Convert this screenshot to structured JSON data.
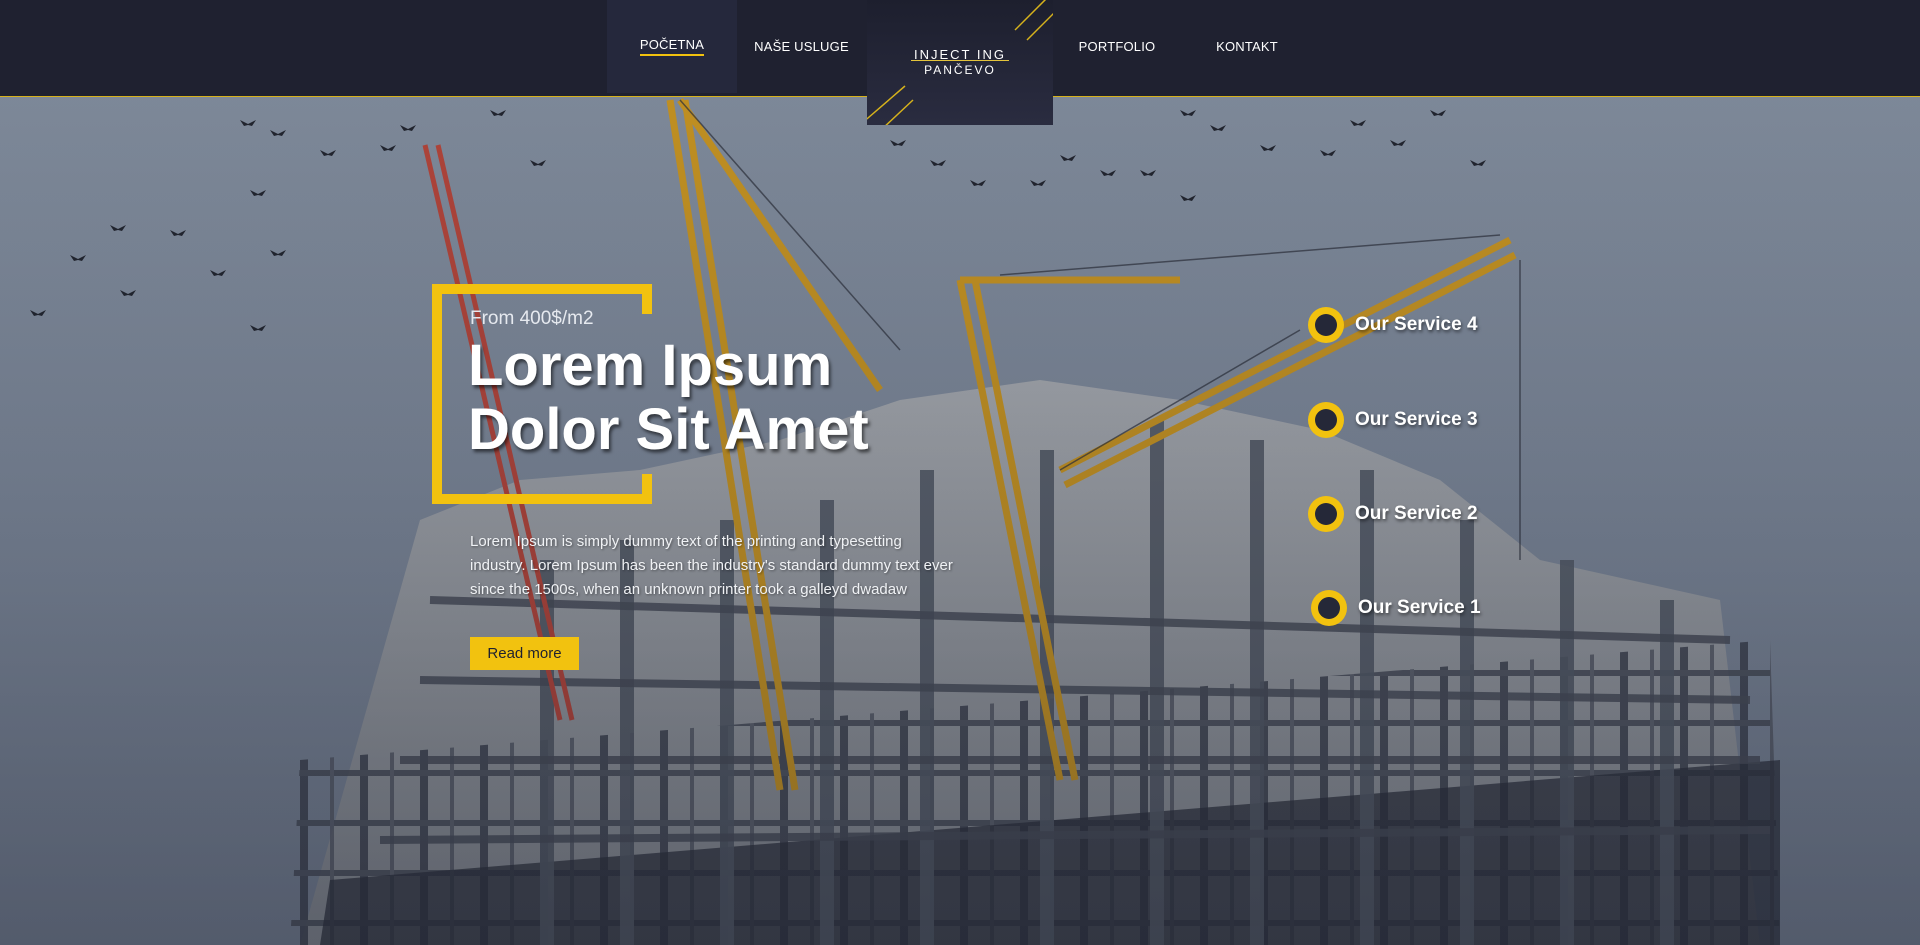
{
  "nav": {
    "items": [
      {
        "label": "POČETNA",
        "active": true
      },
      {
        "label": "NAŠE USLUGE",
        "active": false
      },
      {
        "label": "PORTFOLIO",
        "active": false
      },
      {
        "label": "KONTAKT",
        "active": false
      }
    ]
  },
  "logo": {
    "line1": "INJECT ING",
    "line2": "PANČEVO"
  },
  "hero": {
    "eyebrow": "From 400$/m2",
    "title_line1": "Lorem Ipsum",
    "title_line2": "Dolor Sit Amet",
    "body": "Lorem Ipsum is simply dummy text of the printing and typesetting industry. Lorem Ipsum has been the industry's standard dummy text ever since the 1500s, when an unknown printer took a galleyd dwadaw",
    "button_label": "Read more"
  },
  "services": [
    {
      "label": "Our Service 4"
    },
    {
      "label": "Our Service 3"
    },
    {
      "label": "Our Service 2"
    },
    {
      "label": "Our Service 1"
    }
  ],
  "colors": {
    "accent": "#f2c20f",
    "header_bg": "#1f2130",
    "dot_inner": "#252838"
  },
  "icons": {
    "service_marker": "circle-dot-icon"
  }
}
